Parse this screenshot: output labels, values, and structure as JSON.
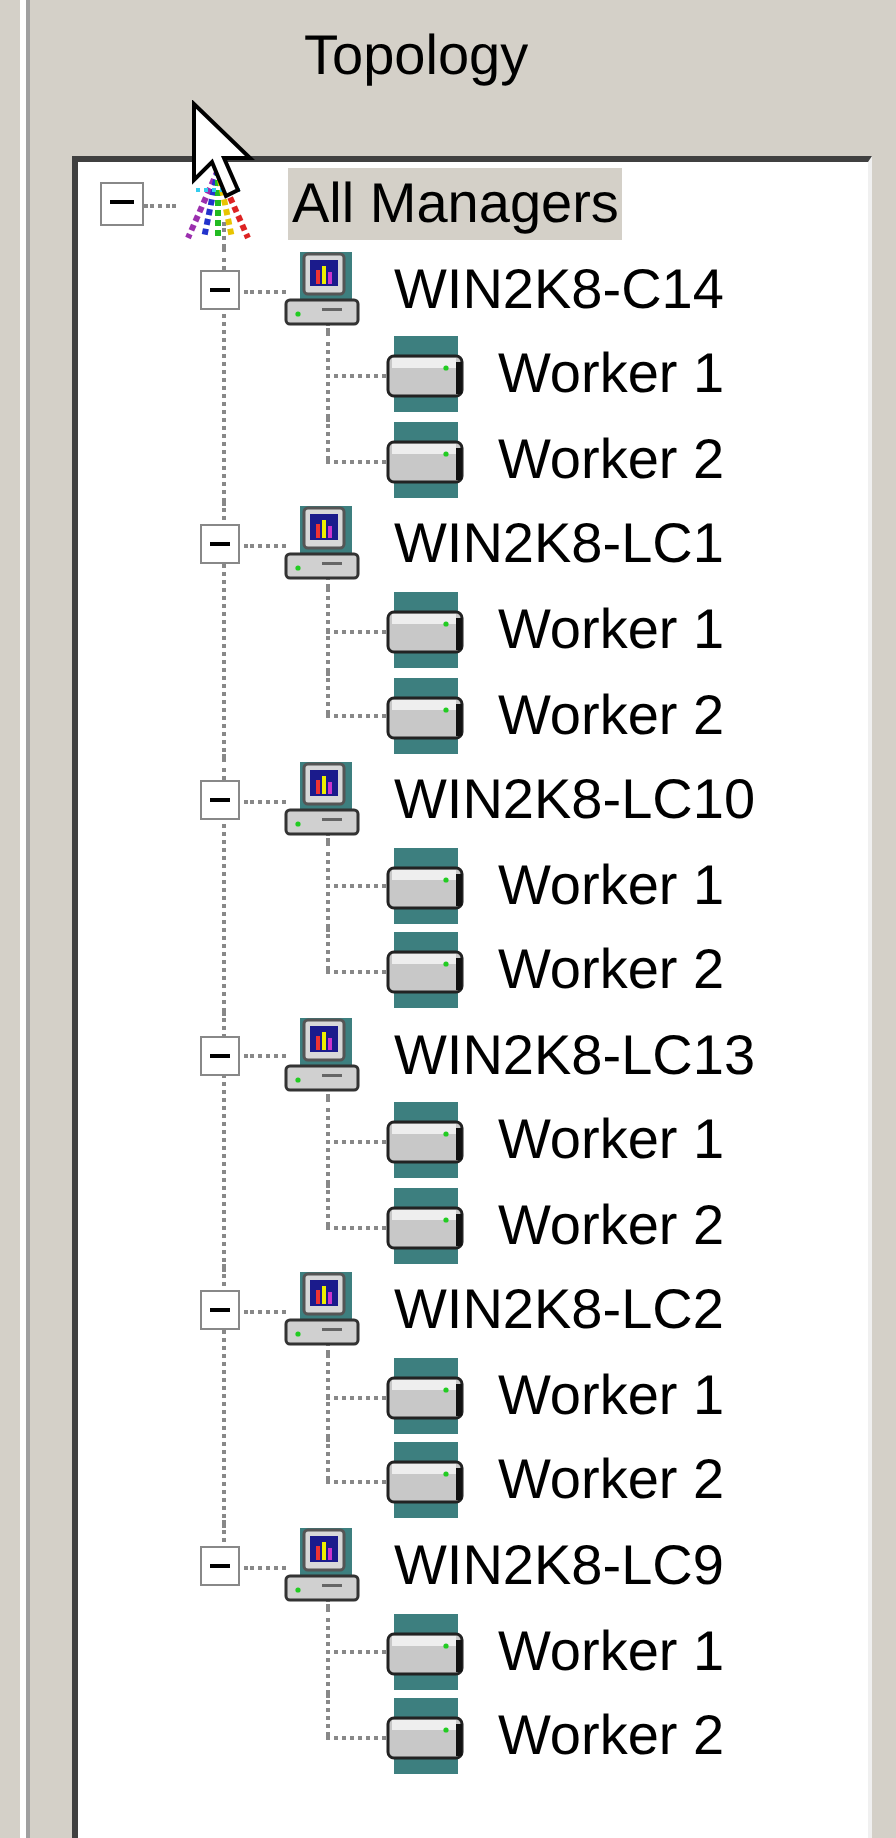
{
  "title": "Topology",
  "tree": {
    "label": "All Managers",
    "selected": true,
    "expanded": true,
    "children": [
      {
        "label": "WIN2K8-C14",
        "selected": false,
        "expanded": true,
        "children": [
          {
            "label": "Worker 1",
            "selected": false
          },
          {
            "label": "Worker 2",
            "selected": false
          }
        ]
      },
      {
        "label": "WIN2K8-LC1",
        "selected": false,
        "expanded": true,
        "children": [
          {
            "label": "Worker 1",
            "selected": false
          },
          {
            "label": "Worker 2",
            "selected": false
          }
        ]
      },
      {
        "label": "WIN2K8-LC10",
        "selected": false,
        "expanded": true,
        "children": [
          {
            "label": "Worker 1",
            "selected": false
          },
          {
            "label": "Worker 2",
            "selected": false
          }
        ]
      },
      {
        "label": "WIN2K8-LC13",
        "selected": false,
        "expanded": true,
        "children": [
          {
            "label": "Worker 1",
            "selected": false
          },
          {
            "label": "Worker 2",
            "selected": false
          }
        ]
      },
      {
        "label": "WIN2K8-LC2",
        "selected": false,
        "expanded": true,
        "children": [
          {
            "label": "Worker 1",
            "selected": false
          },
          {
            "label": "Worker 2",
            "selected": false
          }
        ]
      },
      {
        "label": "WIN2K8-LC9",
        "selected": false,
        "expanded": true,
        "children": [
          {
            "label": "Worker 1",
            "selected": false
          },
          {
            "label": "Worker 2",
            "selected": false
          }
        ]
      }
    ]
  }
}
